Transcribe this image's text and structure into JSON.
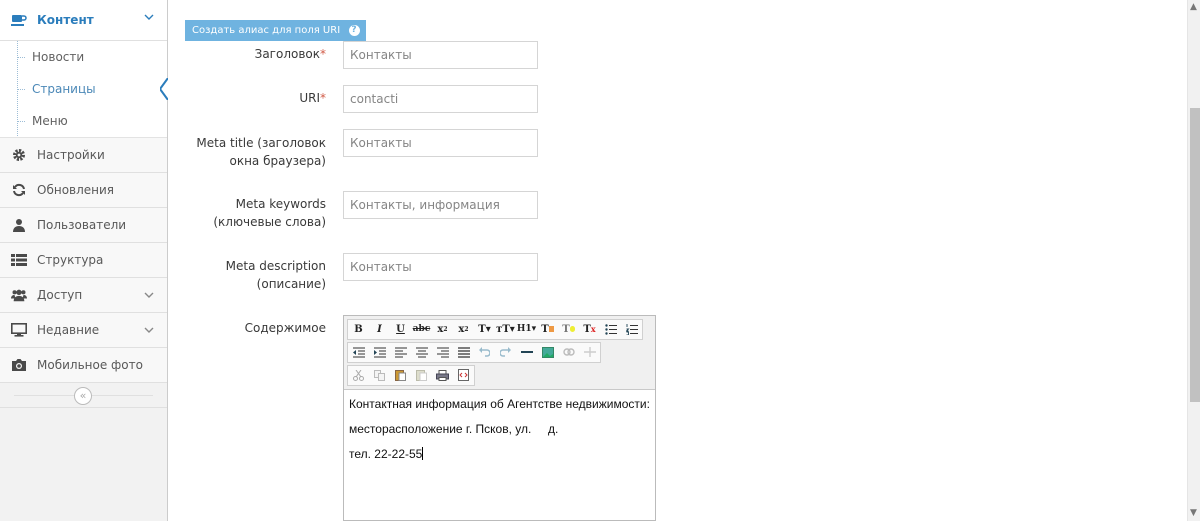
{
  "sidebar": {
    "content": {
      "label": "Контент",
      "icon": "coffee-icon"
    },
    "sub_items": [
      {
        "label": "Новости"
      },
      {
        "label": "Страницы"
      },
      {
        "label": "Меню"
      }
    ],
    "items": [
      {
        "label": "Настройки",
        "icon": "gear-icon"
      },
      {
        "label": "Обновления",
        "icon": "refresh-icon"
      },
      {
        "label": "Пользователи",
        "icon": "user-icon"
      },
      {
        "label": "Структура",
        "icon": "list-icon"
      },
      {
        "label": "Доступ",
        "icon": "users-icon"
      },
      {
        "label": "Недавние",
        "icon": "desktop-icon"
      },
      {
        "label": "Мобильное фото",
        "icon": "camera-icon"
      }
    ],
    "collapse_glyph": "«"
  },
  "form": {
    "alias_button": "Создать алиас для поля URI",
    "help_glyph": "?",
    "title_label": "Заголовок",
    "title_value": "Контакты",
    "uri_label": "URI",
    "uri_value": "contacti",
    "required_mark": "*",
    "meta_title_label_1": "Meta title (заголовок",
    "meta_title_label_2": "окна браузера)",
    "meta_title_value": "Контакты",
    "meta_keywords_label_1": "Meta keywords",
    "meta_keywords_label_2": "(ключевые слова)",
    "meta_keywords_value": "Контакты, информация",
    "meta_description_label_1": "Meta description",
    "meta_description_label_2": "(описание)",
    "meta_description_value": "Контакты",
    "content_label": "Содержимое"
  },
  "editor": {
    "line1": "Контактная информация об Агентстве недвижимости:",
    "line2": "месторасположение г. Псков, ул.     д.",
    "line3": "тел. 22-22-55"
  },
  "colors": {
    "accent": "#2b7dbc",
    "button": "#6fb3e0",
    "required": "#d15b47"
  }
}
